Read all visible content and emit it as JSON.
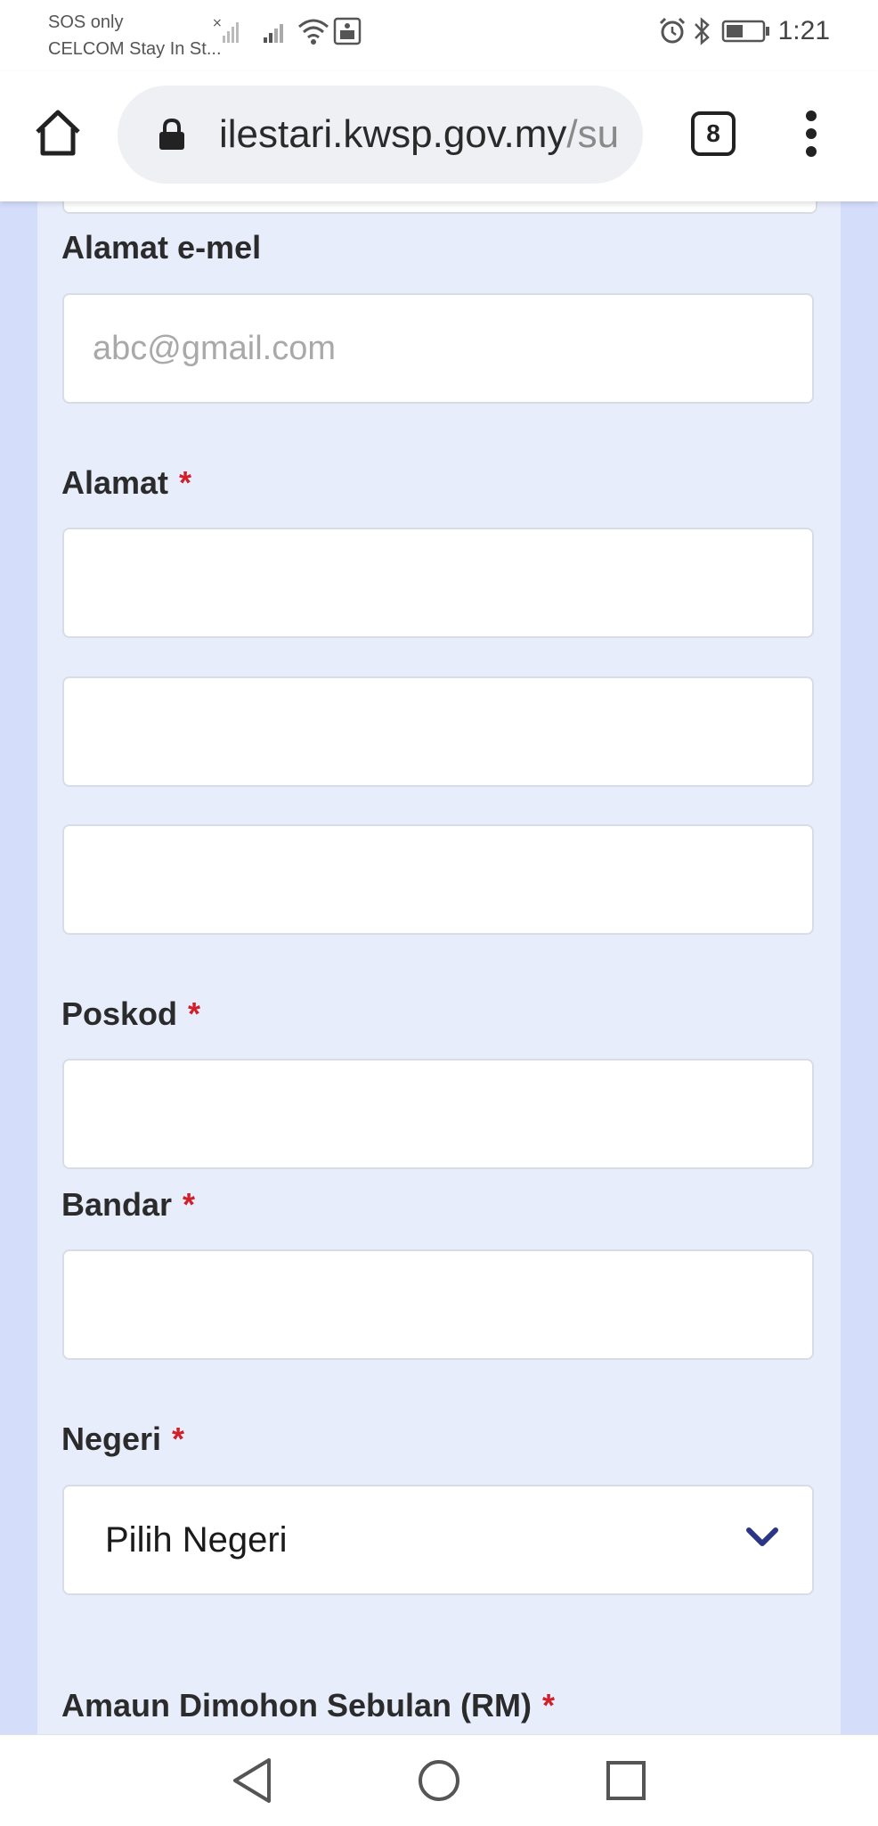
{
  "status_bar": {
    "carrier_line1": "SOS only",
    "carrier_line2": "CELCOM Stay In St...",
    "time": "1:21"
  },
  "browser": {
    "url_host": "ilestari.kwsp.gov.my",
    "url_path": "/su",
    "tab_count": "8"
  },
  "form": {
    "email": {
      "label": "Alamat e-mel",
      "placeholder": "abc@gmail.com",
      "value": ""
    },
    "address": {
      "label": "Alamat",
      "required_mark": "*",
      "line1": "",
      "line2": "",
      "line3": ""
    },
    "postcode": {
      "label": "Poskod",
      "required_mark": "*",
      "value": ""
    },
    "city": {
      "label": "Bandar",
      "required_mark": "*",
      "value": ""
    },
    "state": {
      "label": "Negeri",
      "required_mark": "*",
      "selected": "Pilih Negeri"
    },
    "monthly_amount": {
      "label": "Amaun Dimohon Sebulan (RM)",
      "required_mark": "*"
    }
  },
  "colors": {
    "page_background": "#d4defb",
    "card_background": "#e8edfc",
    "required_mark": "#d0202a",
    "chevron": "#2a3585"
  },
  "icons": {
    "home": "home-icon",
    "lock": "lock-icon",
    "menu": "more-vert-icon",
    "chevron": "chevron-down-icon",
    "back": "triangle-back-icon",
    "home_nav": "circle-home-icon",
    "recents": "square-recents-icon"
  }
}
